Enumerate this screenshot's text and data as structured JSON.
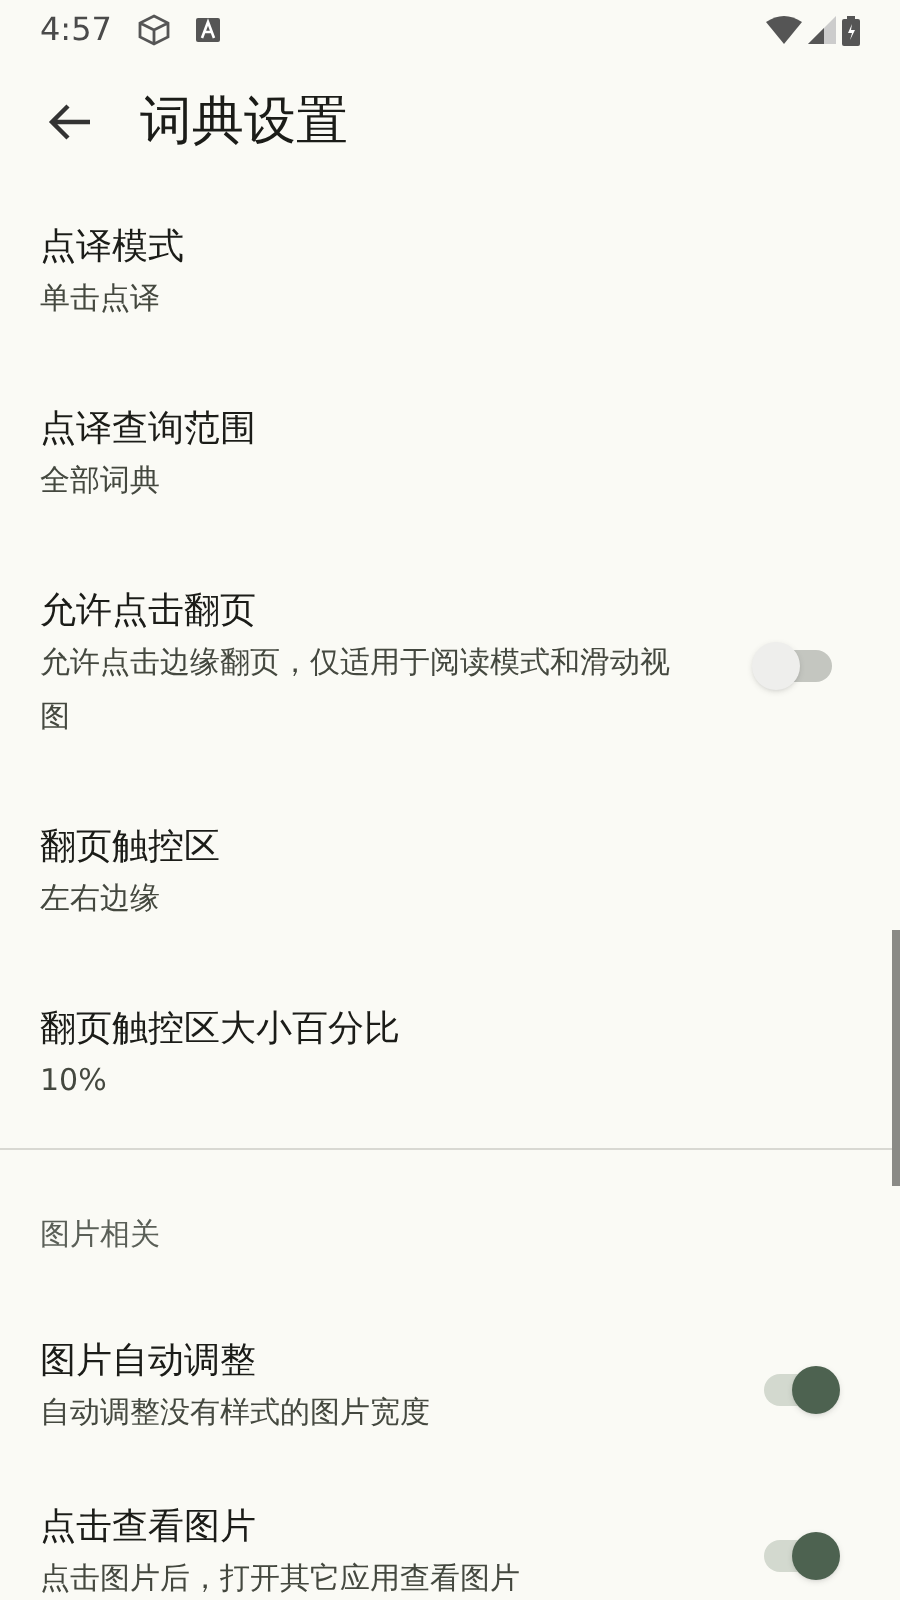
{
  "status_bar": {
    "time": "4:57"
  },
  "toolbar": {
    "title": "词典设置"
  },
  "sections": [
    {
      "items": [
        {
          "kind": "text",
          "title": "点译模式",
          "summary": "单击点译"
        },
        {
          "kind": "text",
          "title": "点译查询范围",
          "summary": "全部词典"
        },
        {
          "kind": "switch",
          "title": "允许点击翻页",
          "summary": "允许点击边缘翻页，仅适用于阅读模式和滑动视图",
          "on": false
        },
        {
          "kind": "text",
          "title": "翻页触控区",
          "summary": "左右边缘"
        },
        {
          "kind": "text",
          "title": "翻页触控区大小百分比",
          "summary": "10%"
        }
      ]
    },
    {
      "header": "图片相关",
      "items": [
        {
          "kind": "switch",
          "title": "图片自动调整",
          "summary": "自动调整没有样式的图片宽度",
          "on": true
        },
        {
          "kind": "switch",
          "title": "点击查看图片",
          "summary": "点击图片后，打开其它应用查看图片",
          "on": true
        }
      ]
    }
  ]
}
